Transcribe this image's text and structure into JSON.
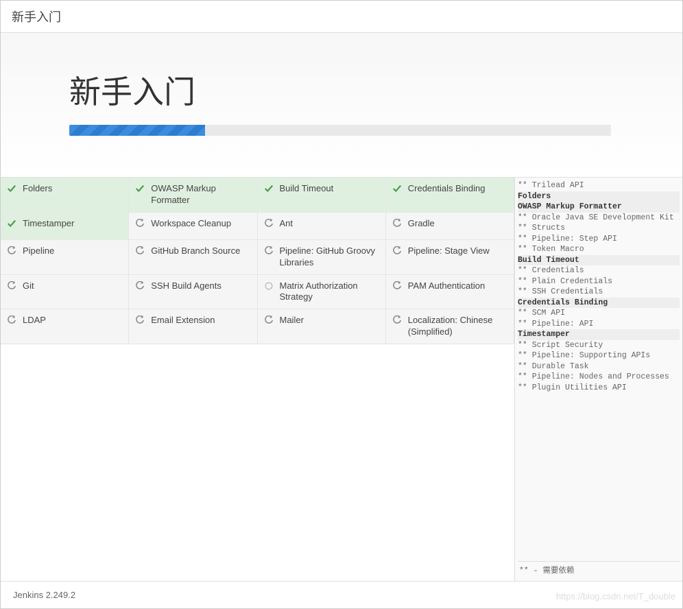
{
  "header": {
    "title": "新手入门"
  },
  "main": {
    "heading": "新手入门",
    "progress_percent": 25
  },
  "plugins": [
    {
      "name": "Folders",
      "status": "done"
    },
    {
      "name": "OWASP Markup Formatter",
      "status": "done"
    },
    {
      "name": "Build Timeout",
      "status": "done"
    },
    {
      "name": "Credentials Binding",
      "status": "done"
    },
    {
      "name": "Timestamper",
      "status": "done"
    },
    {
      "name": "Workspace Cleanup",
      "status": "pending"
    },
    {
      "name": "Ant",
      "status": "pending"
    },
    {
      "name": "Gradle",
      "status": "pending"
    },
    {
      "name": "Pipeline",
      "status": "pending"
    },
    {
      "name": "GitHub Branch Source",
      "status": "pending"
    },
    {
      "name": "Pipeline: GitHub Groovy Libraries",
      "status": "pending"
    },
    {
      "name": "Pipeline: Stage View",
      "status": "pending"
    },
    {
      "name": "Git",
      "status": "pending"
    },
    {
      "name": "SSH Build Agents",
      "status": "pending"
    },
    {
      "name": "Matrix Authorization Strategy",
      "status": "active"
    },
    {
      "name": "PAM Authentication",
      "status": "pending"
    },
    {
      "name": "LDAP",
      "status": "pending"
    },
    {
      "name": "Email Extension",
      "status": "pending"
    },
    {
      "name": "Mailer",
      "status": "pending"
    },
    {
      "name": "Localization: Chinese (Simplified)",
      "status": "pending"
    }
  ],
  "log": [
    {
      "text": "** Trilead API",
      "bold": false
    },
    {
      "text": "Folders",
      "bold": true
    },
    {
      "text": "OWASP Markup Formatter",
      "bold": true
    },
    {
      "text": "** Oracle Java SE Development Kit Installer",
      "bold": false
    },
    {
      "text": "** Structs",
      "bold": false
    },
    {
      "text": "** Pipeline: Step API",
      "bold": false
    },
    {
      "text": "** Token Macro",
      "bold": false
    },
    {
      "text": "Build Timeout",
      "bold": true
    },
    {
      "text": "** Credentials",
      "bold": false
    },
    {
      "text": "** Plain Credentials",
      "bold": false
    },
    {
      "text": "** SSH Credentials",
      "bold": false
    },
    {
      "text": "Credentials Binding",
      "bold": true
    },
    {
      "text": "** SCM API",
      "bold": false
    },
    {
      "text": "** Pipeline: API",
      "bold": false
    },
    {
      "text": "Timestamper",
      "bold": true
    },
    {
      "text": "** Script Security",
      "bold": false
    },
    {
      "text": "** Pipeline: Supporting APIs",
      "bold": false
    },
    {
      "text": "** Durable Task",
      "bold": false
    },
    {
      "text": "** Pipeline: Nodes and Processes",
      "bold": false
    },
    {
      "text": "** Plugin Utilities API",
      "bold": false
    }
  ],
  "log_footer": "** - 需要依赖",
  "footer": {
    "version": "Jenkins 2.249.2"
  },
  "watermark": "https://blog.csdn.net/T_double"
}
